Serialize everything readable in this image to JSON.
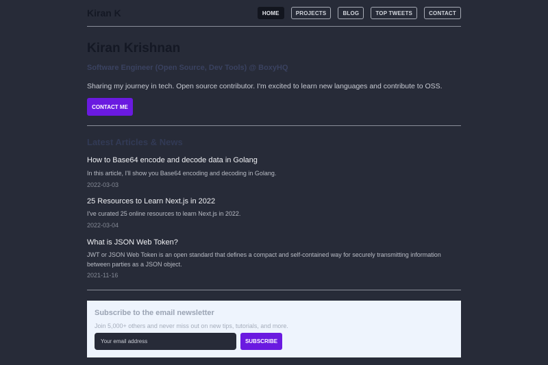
{
  "header": {
    "logo": "Kiran K",
    "nav": [
      {
        "label": "HOME",
        "active": true
      },
      {
        "label": "PROJECTS",
        "active": false
      },
      {
        "label": "BLOG",
        "active": false
      },
      {
        "label": "TOP TWEETS",
        "active": false
      },
      {
        "label": "CONTACT",
        "active": false
      }
    ]
  },
  "hero": {
    "name": "Kiran Krishnan",
    "title": "Software Engineer (Open Source, Dev Tools) @ BoxyHQ",
    "description": "Sharing my journey in tech. Open source contributor. I'm excited to learn new languages and contribute to OSS.",
    "contact_label": "CONTACT ME"
  },
  "articles": {
    "section_title": "Latest Articles & News",
    "items": [
      {
        "title": "How to Base64 encode and decode data in Golang",
        "description": "In this article, I'll show you Base64 encoding and decoding in Golang.",
        "date": "2022-03-03"
      },
      {
        "title": "25 Resources to Learn Next.js in 2022",
        "description": "I've curated 25 online resources to learn Next.js in 2022.",
        "date": "2022-03-04"
      },
      {
        "title": "What is JSON Web Token?",
        "description": "JWT or JSON Web Token is an open standard that defines a compact and self-contained way for securely transmitting information between parties as a JSON object.",
        "date": "2021-11-16"
      }
    ]
  },
  "newsletter": {
    "title": "Subscribe to the email newsletter",
    "subtitle": "Join 5,000+ others and never miss out on new tips, tutorials, and more.",
    "email_placeholder": "Your email address",
    "subscribe_label": "SUBSCRIBE"
  },
  "colors": {
    "background": "#272b38",
    "accent": "#6a1ae0",
    "newsletter_bg": "#eef4fd"
  }
}
